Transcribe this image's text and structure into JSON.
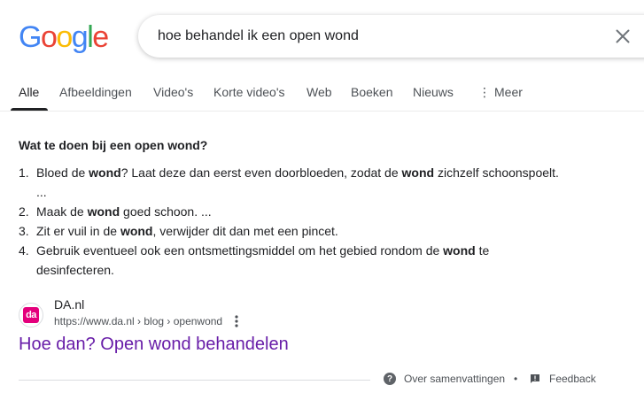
{
  "logo": {
    "letters": [
      "G",
      "o",
      "o",
      "g",
      "l",
      "e"
    ],
    "colors": [
      "#4285F4",
      "#EA4335",
      "#FBBC05",
      "#4285F4",
      "#34A853",
      "#EA4335"
    ]
  },
  "search": {
    "value": "hoe behandel ik een open wond",
    "clear_icon": "close-icon"
  },
  "tabs": [
    {
      "label": "Alle",
      "active": true
    },
    {
      "label": "Afbeeldingen"
    },
    {
      "label": "Video's"
    },
    {
      "label": "Korte video's"
    },
    {
      "label": "Web"
    },
    {
      "label": "Boeken"
    },
    {
      "label": "Nieuws"
    },
    {
      "label": "Meer",
      "icon": "more-vert-icon"
    }
  ],
  "snippet": {
    "heading": "Wat te doen bij een open wond?",
    "items": [
      {
        "num": "1.",
        "parts": [
          "Bloed de ",
          "wond",
          "? Laat deze dan eerst even doorbloeden, zodat de ",
          "wond",
          " zichzelf schoonspoelt."
        ],
        "continuation": "..."
      },
      {
        "num": "2.",
        "parts": [
          "Maak de ",
          "wond",
          " goed schoon. ..."
        ]
      },
      {
        "num": "3.",
        "parts": [
          "Zit er vuil in de ",
          "wond",
          ", verwijder dit dan met een pincet."
        ]
      },
      {
        "num": "4.",
        "parts": [
          "Gebruik eventueel ook een ontsmettingsmiddel om het gebied rondom de ",
          "wond",
          " te"
        ],
        "continuation": "desinfecteren."
      }
    ]
  },
  "result": {
    "favicon_text": "da",
    "favicon_color": "#e4007c",
    "site_name": "DA.nl",
    "url": "https://www.da.nl › blog › openwond",
    "title": "Hoe dan? Open wond behandelen",
    "title_color": "#681da8"
  },
  "footer": {
    "about_label": "Over samenvattingen",
    "about_icon": "help-icon",
    "separator": "•",
    "feedback_label": "Feedback",
    "feedback_icon": "feedback-icon"
  }
}
